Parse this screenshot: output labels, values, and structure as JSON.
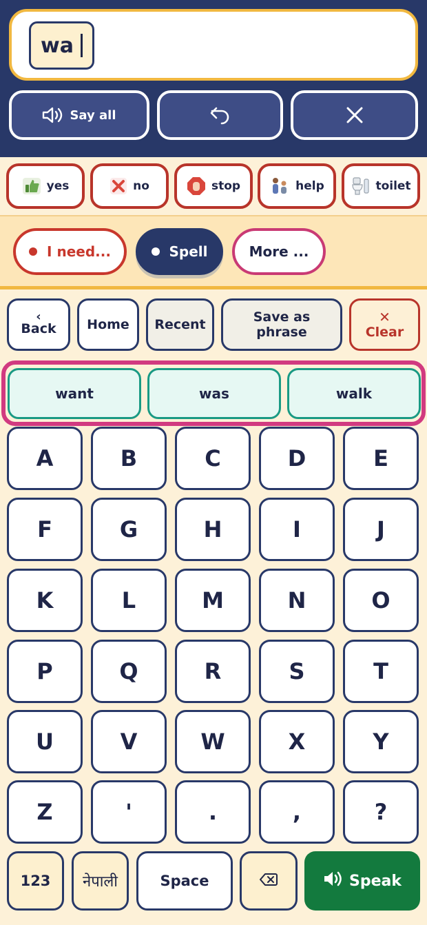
{
  "message": {
    "typed_word": "wa"
  },
  "top_buttons": {
    "say_all": "Say all"
  },
  "quick_phrases": [
    {
      "label": "yes",
      "icon": "thumbs-up-icon"
    },
    {
      "label": "no",
      "icon": "cross-icon"
    },
    {
      "label": "stop",
      "icon": "stop-hand-icon"
    },
    {
      "label": "help",
      "icon": "help-person-icon"
    },
    {
      "label": "toilet",
      "icon": "toilet-icon"
    }
  ],
  "modes": {
    "need": "I need...",
    "spell": "Spell",
    "more": "More ..."
  },
  "nav": {
    "back_arrow": "‹",
    "back": "Back",
    "home": "Home",
    "recent": "Recent",
    "save_line1": "Save as",
    "save_line2": "phrase",
    "clear_icon": "✕",
    "clear": "Clear"
  },
  "suggestions": [
    "want",
    "was",
    "walk"
  ],
  "keys": [
    [
      "A",
      "B",
      "C",
      "D",
      "E"
    ],
    [
      "F",
      "G",
      "H",
      "I",
      "J"
    ],
    [
      "K",
      "L",
      "M",
      "N",
      "O"
    ],
    [
      "P",
      "Q",
      "R",
      "S",
      "T"
    ],
    [
      "U",
      "V",
      "W",
      "X",
      "Y"
    ],
    [
      "Z",
      "'",
      ".",
      ",",
      "?"
    ]
  ],
  "bottom": {
    "numbers": "123",
    "language": "नेपाली",
    "space": "Space",
    "speak": "Speak"
  },
  "colors": {
    "navy": "#283868",
    "gold": "#f1b840",
    "red": "#b8342a",
    "pink": "#d13a80",
    "teal": "#1a9a84",
    "green": "#137a3e",
    "cream": "#fdf1d8"
  }
}
